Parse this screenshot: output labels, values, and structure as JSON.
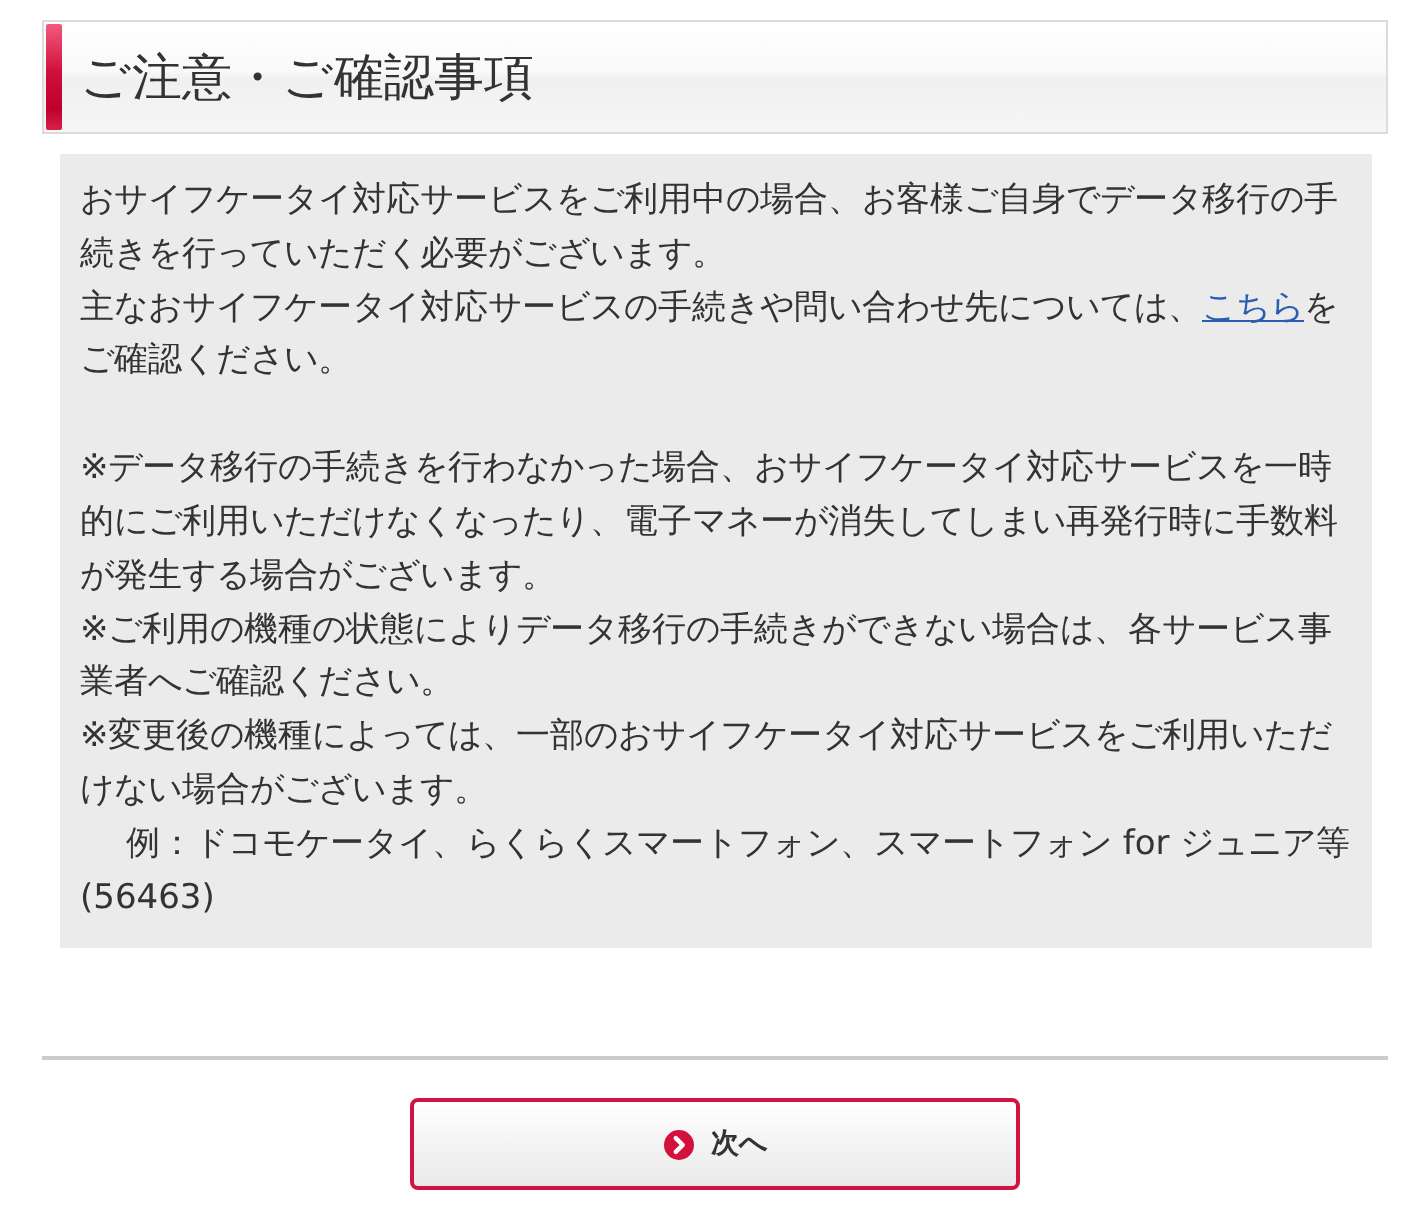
{
  "heading": {
    "title": "ご注意・ご確認事項"
  },
  "notice": {
    "blocks": [
      {
        "lines": [
          {
            "kind": "text",
            "text": "おサイフケータイ対応サービスをご利用中の場合、お客様ご自身でデータ移行の手続きを行っていただく必要がございます。"
          },
          {
            "kind": "link",
            "before": "主なおサイフケータイ対応サービスの手続きや問い合わせ先については、",
            "link": "こちら",
            "after": "をご確認ください。"
          }
        ]
      },
      {
        "lines": [
          {
            "kind": "text",
            "text": "※データ移行の手続きを行わなかった場合、おサイフケータイ対応サービスを一時的にご利用いただけなくなったり、電子マネーが消失してしまい再発行時に手数料が発生する場合がございます。"
          },
          {
            "kind": "text",
            "text": "※ご利用の機種の状態によりデータ移行の手続きができない場合は、各サービス事業者へご確認ください。"
          },
          {
            "kind": "text",
            "text": "※変更後の機種によっては、一部のおサイフケータイ対応サービスをご利用いただけない場合がございます。"
          },
          {
            "kind": "example",
            "text": "例：ドコモケータイ、らくらくスマートフォン、スマートフォン for ジュニア等(56463)"
          }
        ]
      }
    ]
  },
  "next_button": {
    "label": "次へ"
  }
}
